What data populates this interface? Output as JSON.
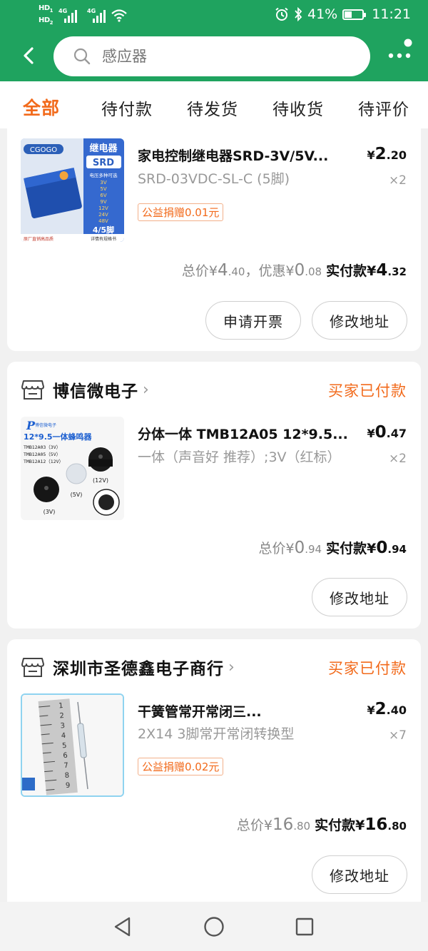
{
  "status_bar": {
    "hd1": "HD",
    "hd1_sub": "1",
    "hd2": "HD",
    "hd2_sub": "2",
    "net1": "4G",
    "net2": "4G",
    "battery_pct": "41%",
    "battery_level": 0.41,
    "time": "11:21"
  },
  "search": {
    "placeholder": "感应器"
  },
  "tabs": [
    {
      "label": "全部",
      "active": true
    },
    {
      "label": "待付款"
    },
    {
      "label": "待发货"
    },
    {
      "label": "待收货"
    },
    {
      "label": "待评价"
    }
  ],
  "orders": [
    {
      "title": "家电控制继电器SRD-3V/5V...",
      "spec": "SRD-03VDC-SL-C (5脚)",
      "price_symbol": "¥",
      "price_int": "2",
      "price_dec": ".20",
      "qty": "×2",
      "badge": "公益捐赠0.01元",
      "thumb": {
        "brand": "CGOGO",
        "heading1": "继电器",
        "heading2": "SRD",
        "subtitle": "电压多种可选",
        "voltages": [
          "3V",
          "5V",
          "6V",
          "9V",
          "12V",
          "24V",
          "48V"
        ],
        "pins": "4/5脚",
        "footer_left": "原厂直销高品质",
        "footer_right": "详情有规格书"
      },
      "totals": {
        "total_label": "总价",
        "currency": "¥",
        "total_int": "4",
        "total_dec": ".40",
        "sep": "，",
        "discount_label": "优惠",
        "discount_int": "0",
        "discount_dec": ".08",
        "paid_label": "实付款",
        "paid_int": "4",
        "paid_dec": ".32"
      },
      "buttons": [
        "申请开票",
        "修改地址"
      ]
    },
    {
      "shop": "博信微电子",
      "status": "买家已付款",
      "title": "分体一体 TMB12A05 12*9.5...",
      "spec": "一体（声音好 推荐）;3V（红标）",
      "price_symbol": "¥",
      "price_int": "0",
      "price_dec": ".47",
      "qty": "×2",
      "thumb": {
        "brand": "博信微电子",
        "heading": "12*9.5一体蜂鸣器",
        "models": [
          "TMB12A03（3V）",
          "TMB12A05（5V）",
          "TMB12A12（12V）"
        ],
        "labels": [
          "(12V)",
          "(5V)",
          "(3V)"
        ]
      },
      "totals": {
        "total_label": "总价",
        "currency": "¥",
        "total_int": "0",
        "total_dec": ".94",
        "paid_label": "实付款",
        "paid_int": "0",
        "paid_dec": ".94"
      },
      "buttons": [
        "修改地址"
      ]
    },
    {
      "shop": "深圳市圣德鑫电子商行",
      "status": "买家已付款",
      "title": "干簧管常开常闭三...",
      "spec": "2X14 3脚常开常闭转换型",
      "price_symbol": "¥",
      "price_int": "2",
      "price_dec": ".40",
      "qty": "×7",
      "badge": "公益捐赠0.02元",
      "thumb": {
        "ruler_digits": [
          "1",
          "2",
          "3",
          "4",
          "5",
          "6",
          "7",
          "8",
          "9"
        ]
      },
      "totals": {
        "total_label": "总价",
        "currency": "¥",
        "total_int": "16",
        "total_dec": ".80",
        "paid_label": "实付款",
        "paid_int": "16",
        "paid_dec": ".80"
      },
      "buttons": [
        "修改地址"
      ]
    }
  ],
  "colors": {
    "brand_green": "#1fa35f",
    "accent_orange": "#f26a1b"
  },
  "icons": {
    "back": "back-arrow-icon",
    "search": "search-icon",
    "more": "more-dots-icon",
    "shop": "shop-icon",
    "nav_back": "nav-back-icon",
    "nav_home": "nav-home-icon",
    "nav_recent": "nav-recent-icon"
  }
}
